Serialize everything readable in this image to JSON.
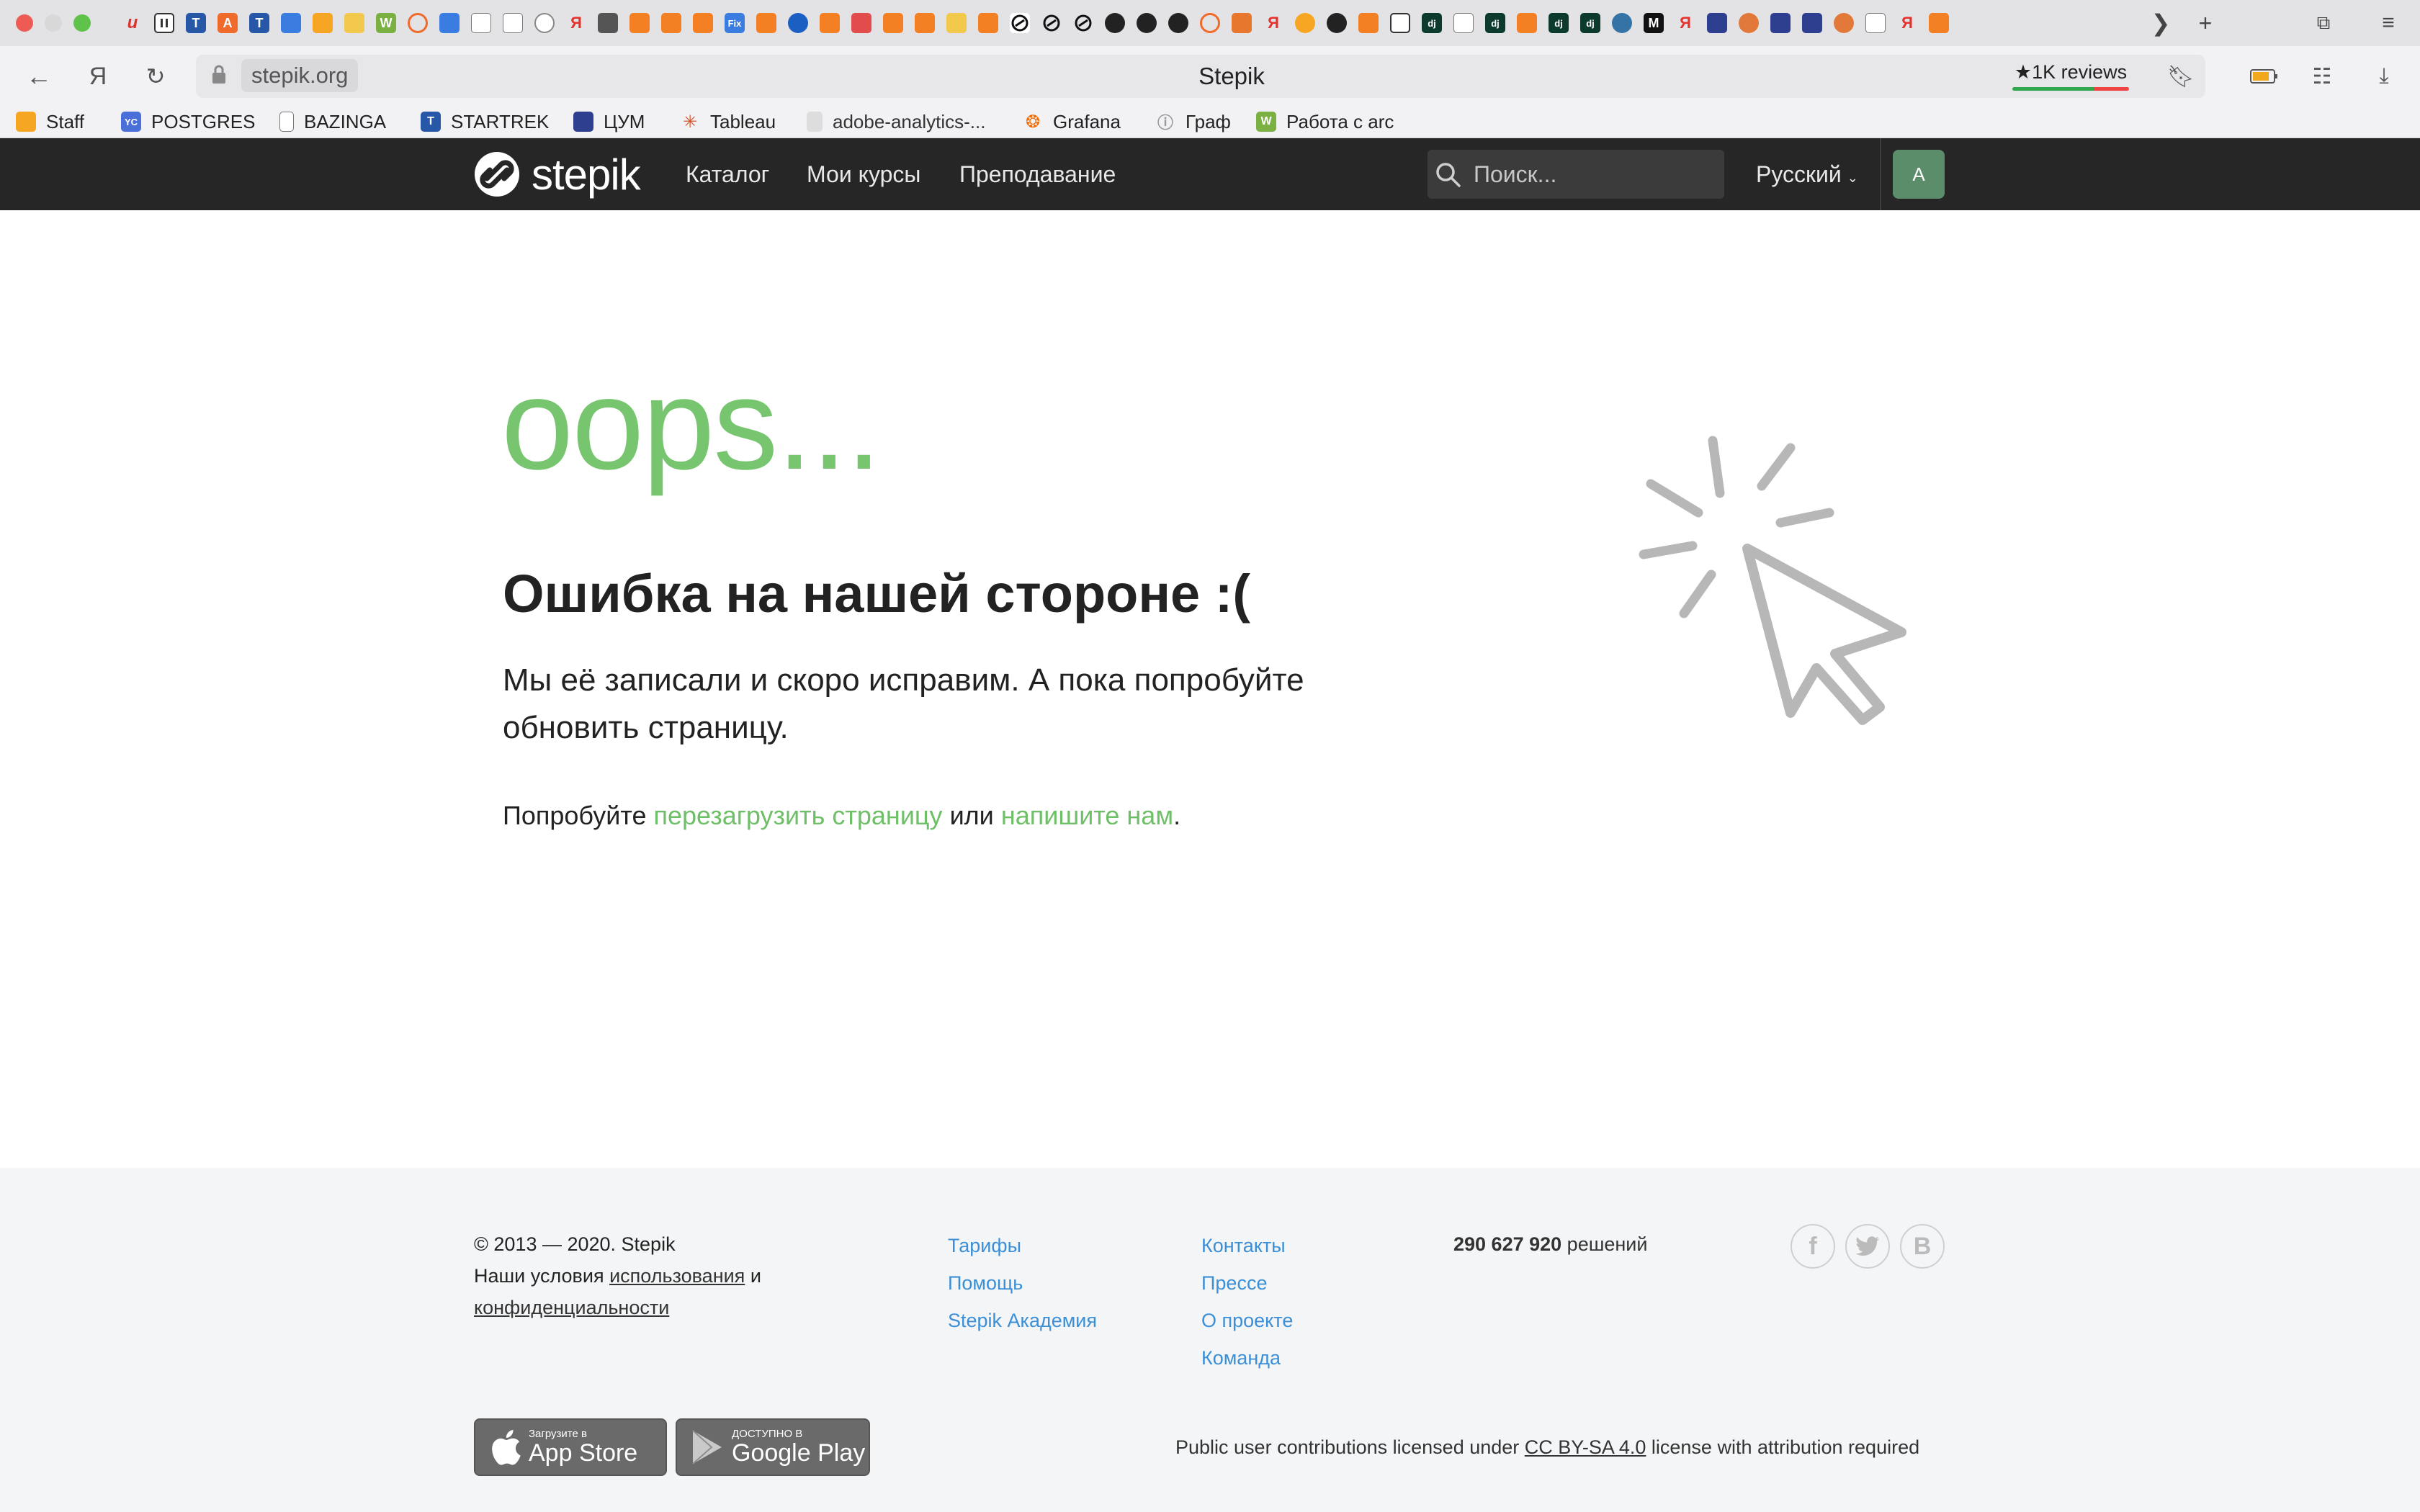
{
  "browser": {
    "url": "stepik.org",
    "page_title": "Stepik",
    "reviews_badge": "★1K reviews",
    "bookmarks": [
      {
        "label": "Staff",
        "icon": "staff-favicon"
      },
      {
        "label": "POSTGRES",
        "icon": "yc-favicon"
      },
      {
        "label": "BAZINGA",
        "icon": "document-icon"
      },
      {
        "label": "STARTREK",
        "icon": "startrek-favicon"
      },
      {
        "label": "ЦУМ",
        "icon": "cart-icon"
      },
      {
        "label": "Tableau",
        "icon": "tableau-favicon"
      },
      {
        "label": "adobe-analytics-...",
        "icon": "document-icon"
      },
      {
        "label": "Grafana",
        "icon": "grafana-favicon"
      },
      {
        "label": "Граф",
        "icon": "info-icon"
      },
      {
        "label": "Работа с arc",
        "icon": "w-favicon"
      }
    ],
    "tab_badges": {
      "yc": "YC",
      "w": "W",
      "fix": "Fix",
      "dj": "dj",
      "m": "M",
      "ya": "Я"
    }
  },
  "nav": {
    "logo": "stepik",
    "catalog": "Каталог",
    "my_courses": "Мои курсы",
    "teaching": "Преподавание",
    "search_placeholder": "Поиск...",
    "language": "Русский",
    "avatar_letter": "A"
  },
  "error": {
    "oops": "oops...",
    "title": "Ошибка на нашей стороне :(",
    "body_line1": "Мы её записали и скоро исправим. А пока попробуйте",
    "body_line2": "обновить страницу.",
    "try_prefix": "Попробуйте",
    "reload_link": "перезагрузить страницу",
    "try_middle": "или",
    "write_link": "напишите нам",
    "try_suffix": "."
  },
  "footer": {
    "copyright": "© 2013 — 2020. Stepik",
    "terms_prefix": "Наши условия",
    "terms_link": "использования",
    "terms_and": "и",
    "privacy_link": "конфиденциальности",
    "col1": [
      "Тарифы",
      "Помощь",
      "Stepik Академия"
    ],
    "col2": [
      "Контакты",
      "Прессе",
      "О проекте",
      "Команда"
    ],
    "solutions_count": "290 627 920",
    "solutions_label": "решений",
    "social": [
      "facebook-icon",
      "twitter-icon",
      "vk-icon"
    ],
    "social_letters": {
      "facebook": "f",
      "vk": "B"
    },
    "appstore_small": "Загрузите в",
    "appstore_big": "App Store",
    "googleplay_small": "ДОСТУПНО В",
    "googleplay_big": "Google Play",
    "license_prefix": "Public user contributions licensed under",
    "license_link": "CC BY-SA 4.0",
    "license_suffix": "license with attribution required"
  },
  "colors": {
    "accent_green": "#77c56f",
    "link_blue": "#3b8fd6",
    "nav_bg": "#262626",
    "footer_bg": "#f4f5f6"
  }
}
